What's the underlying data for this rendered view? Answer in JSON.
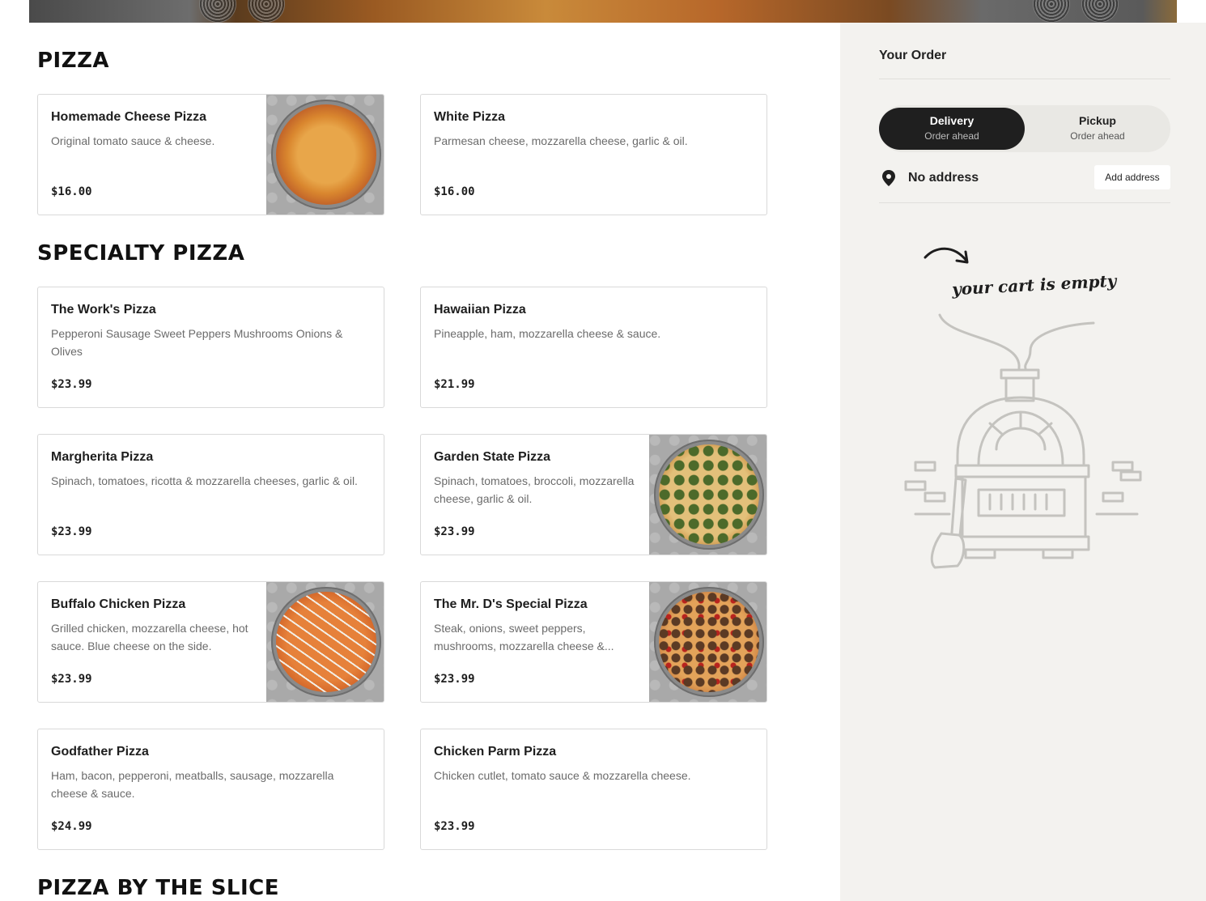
{
  "menu": {
    "sections": {
      "pizza": "PIZZA",
      "specialty": "SPECIALTY PIZZA",
      "slice": "PIZZA BY THE SLICE"
    },
    "items": [
      {
        "name": "Homemade Cheese Pizza",
        "desc": "Original tomato sauce & cheese.",
        "price": "$16.00",
        "image": "cheese-pizza-photo"
      },
      {
        "name": "White Pizza",
        "desc": "Parmesan cheese, mozzarella cheese, garlic & oil.",
        "price": "$16.00"
      },
      {
        "name": "The Work's Pizza",
        "desc": "Pepperoni Sausage Sweet Peppers Mushrooms Onions & Olives",
        "price": "$23.99"
      },
      {
        "name": "Hawaiian Pizza",
        "desc": "Pineapple, ham, mozzarella cheese & sauce.",
        "price": "$21.99"
      },
      {
        "name": "Margherita Pizza",
        "desc": "Spinach, tomatoes, ricotta & mozzarella cheeses, garlic & oil.",
        "price": "$23.99"
      },
      {
        "name": "Garden State Pizza",
        "desc": "Spinach, tomatoes, broccoli, mozzarella cheese, garlic & oil.",
        "price": "$23.99",
        "image": "garden-pizza-photo"
      },
      {
        "name": "Buffalo Chicken Pizza",
        "desc": "Grilled chicken, mozzarella cheese, hot sauce. Blue cheese on the side.",
        "price": "$23.99",
        "image": "buffalo-pizza-photo"
      },
      {
        "name": "The Mr. D's Special Pizza",
        "desc": "Steak, onions, sweet peppers, mushrooms, mozzarella cheese &...",
        "price": "$23.99",
        "image": "special-pizza-photo"
      },
      {
        "name": "Godfather Pizza",
        "desc": "Ham, bacon, pepperoni, meatballs, sausage, mozzarella cheese & sauce.",
        "price": "$24.99"
      },
      {
        "name": "Chicken Parm Pizza",
        "desc": "Chicken cutlet, tomato sauce & mozzarella cheese.",
        "price": "$23.99"
      }
    ]
  },
  "order": {
    "title": "Your Order",
    "delivery": {
      "label": "Delivery",
      "sub": "Order ahead"
    },
    "pickup": {
      "label": "Pickup",
      "sub": "Order ahead"
    },
    "address": "No address",
    "add_address": "Add address",
    "empty_text": "your cart is empty",
    "icons": {
      "pin": "location-pin-icon",
      "arrow": "curved-arrow-icon",
      "illustration": "pizza-oven-illustration"
    }
  },
  "colors": {
    "accent": "#1f1f1f",
    "sidebar_bg": "#f3f2ef",
    "card_border": "#d9d9d9",
    "muted_text": "#6b6b6b"
  }
}
